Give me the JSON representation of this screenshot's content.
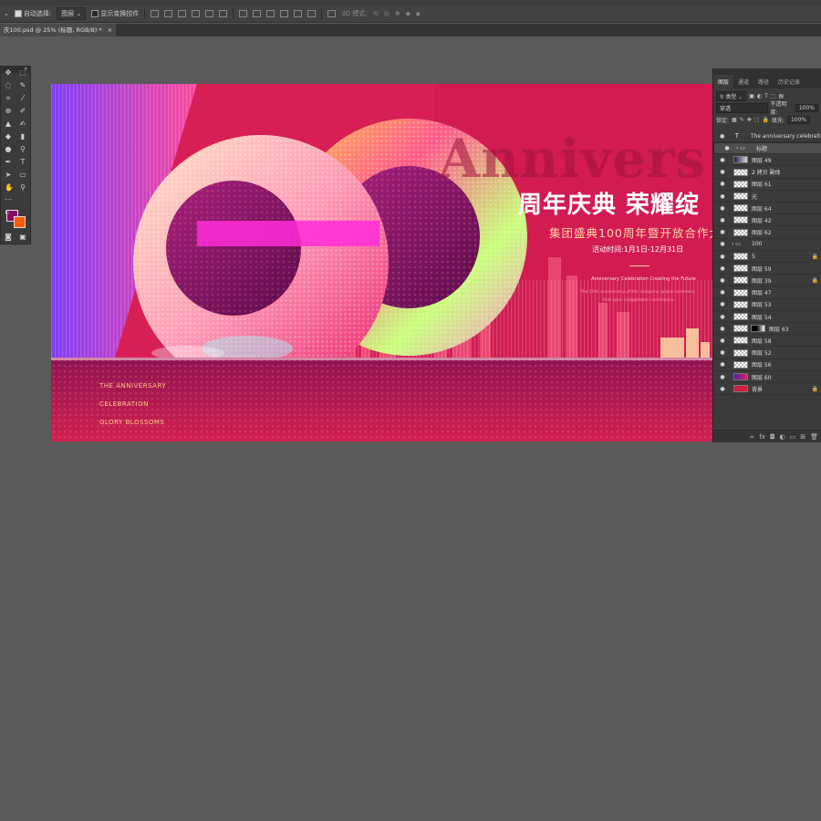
{
  "optbar": {
    "auto_select_label": "自动选择:",
    "auto_select_value": "图层",
    "show_transform_label": "显示变换控件",
    "mode_3d_label": "3D 模式:"
  },
  "doc_tab": {
    "title": "庆100.psd @ 25% (标题, RGB/8) *",
    "close": "×"
  },
  "colors": {
    "foreground": "#8a0b6b",
    "background": "#ff5a00"
  },
  "banner": {
    "watermark": "Annivers",
    "headline": "周年庆典  荣耀绽",
    "subhead": "集团盛典100周年暨开放合作大",
    "event_time": "活动时间:1月1日-12月31日",
    "tagline": "Anniversary Celebration Creating the Future",
    "small1": "The 10th anniversary of the company grand ceremony",
    "small2": "And open cooperation conference",
    "left_lines": [
      "THE ANNIVERSARY",
      "CELEBRATION",
      "GLORY BLOSSOMS"
    ]
  },
  "layers_panel": {
    "tabs": [
      "图层",
      "通道",
      "路径",
      "历史记录"
    ],
    "filter_kind": "类型",
    "blend_mode": "穿透",
    "opacity_label": "不透明度:",
    "opacity_value": "100%",
    "lock_label": "锁定:",
    "fill_label": "填充:",
    "fill_value": "100%",
    "layers": [
      {
        "name": "The anniversary celebrati...",
        "kind": "text",
        "lock": false,
        "selected": false
      },
      {
        "name": "标题",
        "kind": "group",
        "lock": false,
        "selected": true
      },
      {
        "name": "图层 49",
        "kind": "layer",
        "lock": false,
        "selected": false
      },
      {
        "name": "2 拷贝 副体",
        "kind": "layer",
        "lock": false,
        "selected": false
      },
      {
        "name": "图层 61",
        "kind": "layer",
        "lock": false,
        "selected": false
      },
      {
        "name": "光",
        "kind": "layer",
        "lock": false,
        "selected": false
      },
      {
        "name": "图层 64",
        "kind": "layer",
        "lock": false,
        "selected": false
      },
      {
        "name": "图层 42",
        "kind": "layer",
        "lock": false,
        "selected": false
      },
      {
        "name": "图层 62",
        "kind": "layer",
        "lock": false,
        "selected": false
      },
      {
        "name": "100",
        "kind": "group",
        "lock": false,
        "selected": false
      },
      {
        "name": "5",
        "kind": "layer",
        "lock": true,
        "selected": false
      },
      {
        "name": "图层 59",
        "kind": "layer",
        "lock": false,
        "selected": false
      },
      {
        "name": "图层 39",
        "kind": "layer",
        "lock": true,
        "selected": false
      },
      {
        "name": "图层 47",
        "kind": "layer",
        "lock": false,
        "selected": false
      },
      {
        "name": "图层 53",
        "kind": "layer",
        "lock": false,
        "selected": false
      },
      {
        "name": "图层 54",
        "kind": "layer",
        "lock": false,
        "selected": false
      },
      {
        "name": "图层 63",
        "kind": "mask",
        "lock": false,
        "selected": false
      },
      {
        "name": "图层 58",
        "kind": "layer",
        "lock": false,
        "selected": false
      },
      {
        "name": "图层 52",
        "kind": "layer",
        "lock": false,
        "selected": false
      },
      {
        "name": "图层 56",
        "kind": "layer",
        "lock": false,
        "selected": false
      },
      {
        "name": "图层 60",
        "kind": "layer",
        "lock": false,
        "selected": false
      },
      {
        "name": "背景",
        "kind": "background",
        "lock": true,
        "selected": false
      }
    ],
    "footer_icons": [
      "link-icon",
      "fx-icon",
      "mask-icon",
      "adjustment-icon",
      "folder-icon",
      "new-layer-icon",
      "trash-icon"
    ]
  }
}
